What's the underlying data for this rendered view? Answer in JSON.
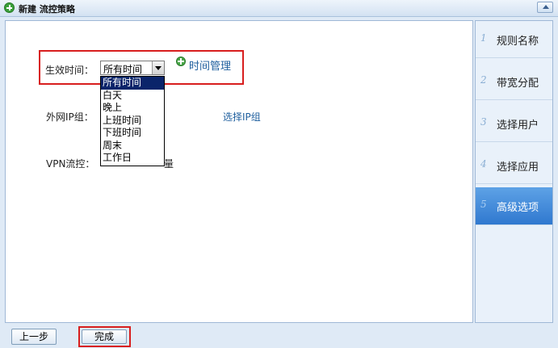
{
  "window": {
    "title": "新建  流控策略"
  },
  "form": {
    "effective_time_label": "生效时间：",
    "effective_time_value": "所有时间",
    "time_manage_link": "时间管理",
    "external_ip_label": "外网IP组：",
    "select_ip_link": "选择IP组",
    "vpn_label": "VPN流控：",
    "vpn_partial": "量",
    "dropdown_options": [
      "所有时间",
      "白天",
      "晚上",
      "上班时间",
      "下班时间",
      "周末",
      "工作日"
    ]
  },
  "sidebar": {
    "items": [
      {
        "num": "1",
        "label": "规则名称",
        "active": false
      },
      {
        "num": "2",
        "label": "带宽分配",
        "active": false
      },
      {
        "num": "3",
        "label": "选择用户",
        "active": false
      },
      {
        "num": "4",
        "label": "选择应用",
        "active": false
      },
      {
        "num": "5",
        "label": "高级选项",
        "active": true
      }
    ]
  },
  "footer": {
    "prev_label": "上一步",
    "finish_label": "完成"
  },
  "colors": {
    "highlight": "#d81e1e",
    "active_tab": "#2f78cf",
    "link": "#1f5f9e"
  }
}
